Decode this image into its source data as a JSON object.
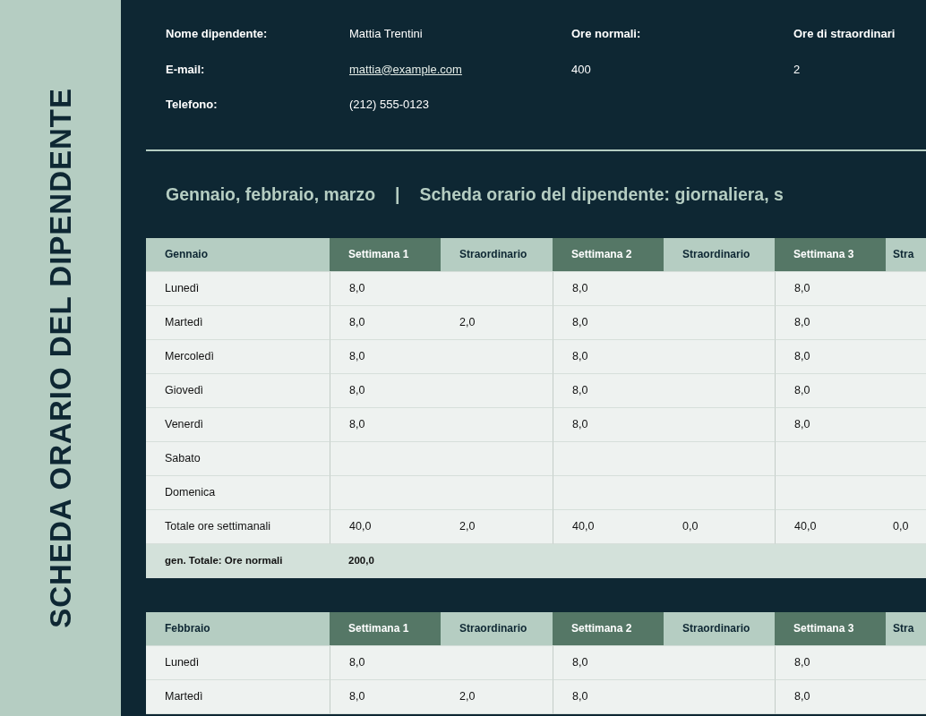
{
  "sidebar": {
    "title": "SCHEDA ORARIO DEL DIPENDENTE"
  },
  "employee": {
    "fields": [
      {
        "label": "Nome dipendente:",
        "value": "Mattia Trentini",
        "kind": "text"
      },
      {
        "label": "E-mail:",
        "value": "mattia@example.com",
        "kind": "link"
      },
      {
        "label": "Telefono:",
        "value": "(212) 555-0123",
        "kind": "text"
      }
    ],
    "hours": [
      {
        "label": "Ore normali:",
        "value": "400"
      },
      {
        "label": "Ore di straordinari",
        "value": "2"
      }
    ]
  },
  "heading": {
    "period": "Gennaio, febbraio, marzo",
    "separator": "|",
    "subtitle": "Scheda orario del dipendente: giornaliera, s"
  },
  "tables": [
    {
      "columns": [
        {
          "label": "Gennaio",
          "kind": "label"
        },
        {
          "label": "Settimana 1",
          "kind": "week"
        },
        {
          "label": "Straordinario",
          "kind": "overtime"
        },
        {
          "label": "Settimana 2",
          "kind": "week"
        },
        {
          "label": "Straordinario",
          "kind": "overtime"
        },
        {
          "label": "Settimana 3",
          "kind": "week"
        },
        {
          "label": "Stra",
          "kind": "overtime"
        }
      ],
      "rows": [
        {
          "label": "Lunedì",
          "kind": "day",
          "cells": {
            "week_1": "8,0",
            "week_2": "8,0",
            "week_3": "8,0"
          }
        },
        {
          "label": "Martedì",
          "kind": "day",
          "cells": {
            "week_1": "8,0",
            "overtime_1": "2,0",
            "week_2": "8,0",
            "week_3": "8,0"
          }
        },
        {
          "label": "Mercoledì",
          "kind": "day",
          "cells": {
            "week_1": "8,0",
            "week_2": "8,0",
            "week_3": "8,0"
          }
        },
        {
          "label": "Giovedì",
          "kind": "day",
          "cells": {
            "week_1": "8,0",
            "week_2": "8,0",
            "week_3": "8,0"
          }
        },
        {
          "label": "Venerdì",
          "kind": "day",
          "cells": {
            "week_1": "8,0",
            "week_2": "8,0",
            "week_3": "8,0"
          }
        },
        {
          "label": "Sabato",
          "kind": "day"
        },
        {
          "label": "Domenica",
          "kind": "day"
        },
        {
          "label": "Totale ore settimanali",
          "kind": "total",
          "cells": {
            "week_1": "40,0",
            "overtime_1": "2,0",
            "week_2": "40,0",
            "overtime_2": "0,0",
            "week_3": "40,0",
            "overtime_3": "0,0"
          }
        },
        {
          "label": "gen. Totale: Ore normali",
          "kind": "grand_total",
          "value": "200,0"
        }
      ]
    },
    {
      "columns": [
        {
          "label": "Febbraio",
          "kind": "label"
        },
        {
          "label": "Settimana 1",
          "kind": "week"
        },
        {
          "label": "Straordinario",
          "kind": "overtime"
        },
        {
          "label": "Settimana 2",
          "kind": "week"
        },
        {
          "label": "Straordinario",
          "kind": "overtime"
        },
        {
          "label": "Settimana 3",
          "kind": "week"
        },
        {
          "label": "Stra",
          "kind": "overtime"
        }
      ],
      "rows": [
        {
          "label": "Lunedì",
          "kind": "day",
          "cells": {
            "week_1": "8,0",
            "week_2": "8,0",
            "week_3": "8,0"
          }
        },
        {
          "label": "Martedì",
          "kind": "day",
          "cells": {
            "week_1": "8,0",
            "overtime_1": "2,0",
            "week_2": "8,0",
            "week_3": "8,0"
          }
        }
      ]
    }
  ]
}
